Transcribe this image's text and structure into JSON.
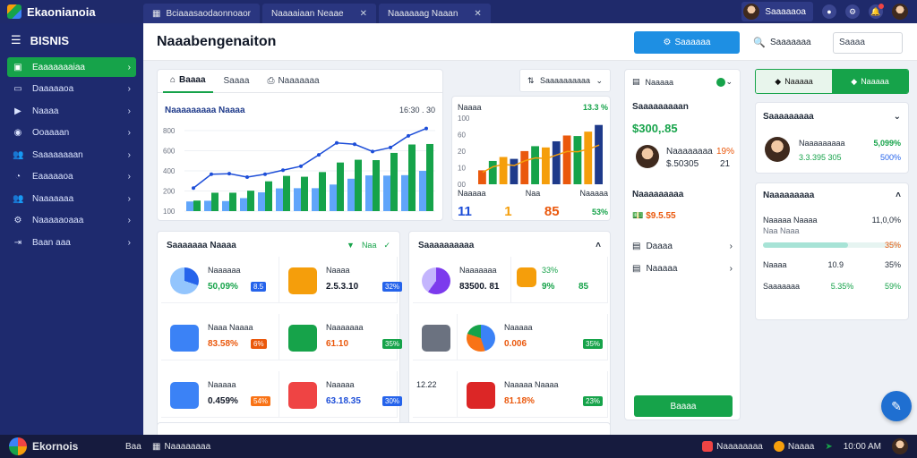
{
  "topbar": {
    "app_name": "Ekaonianoia",
    "tabs": [
      {
        "label": "Bciaaasaodaonnoaor"
      },
      {
        "label": "Naaaaiaan Neaae"
      },
      {
        "label": "Naaaaaag Naaan"
      }
    ],
    "user_name": "Saaaaaoa"
  },
  "sidebar": {
    "title": "BISNIS",
    "items": [
      {
        "label": "Eaaaaaaaiaa",
        "icon": "dashboard-icon"
      },
      {
        "label": "Daaaaaoa",
        "icon": "wallet-icon"
      },
      {
        "label": "Naaaa",
        "icon": "video-icon"
      },
      {
        "label": "Ooaaaan",
        "icon": "target-icon"
      },
      {
        "label": "Saaaaaaaan",
        "icon": "users-icon"
      },
      {
        "label": "Eaaaaaoa",
        "icon": "chart-icon"
      },
      {
        "label": "Naaaaaaa",
        "icon": "users-icon"
      },
      {
        "label": "Naaaaaoaaa",
        "icon": "settings-icon"
      },
      {
        "label": "Baan aaa",
        "icon": "export-icon"
      }
    ]
  },
  "header": {
    "title": "Naaabengenaiton",
    "primary_button": "Saaaaaa",
    "search_label": "Saaaaaaa",
    "search_value": "Saaaa"
  },
  "overview_card": {
    "tabs": [
      "Baaaa",
      "Saaaa",
      "Naaaaaaa"
    ],
    "title": "Naaaaaaaaa Naaaa",
    "range": "16:30 . 30",
    "y_ticks": [
      "800",
      "600",
      "400",
      "200",
      "100"
    ],
    "legend": {
      "bar": "Naaa",
      "line": "Baaa"
    }
  },
  "filter": {
    "label": "Saaaaaaaaaa"
  },
  "mini_chart_card": {
    "label": "Naaaa",
    "change": "13.3 %",
    "y_ticks": [
      "100",
      "60",
      "20",
      "10",
      "00"
    ],
    "stats": [
      {
        "label": "Naaaaa",
        "value": "11"
      },
      {
        "label": "Naa",
        "value": "1"
      },
      {
        "label": "Naaaaa",
        "value": "85"
      }
    ],
    "percent": "53%"
  },
  "section_left": {
    "title": "Saaaaaaa Naaaa",
    "action": "Naa",
    "tiles": [
      {
        "label": "Naaaaaa",
        "value": "50,09%",
        "change": "8.5"
      },
      {
        "label": "Naaaa",
        "value": "2.5.3.10",
        "change": "32%"
      },
      {
        "label": "Naaa Naaaa",
        "value": "83.58%",
        "change": "6%"
      },
      {
        "label": "Naaaaaaa",
        "value": "61.10",
        "change": "35%"
      },
      {
        "label": "Naaaaa",
        "value": "0.459%",
        "change": "54%"
      },
      {
        "label": "Naaaaa",
        "value": "63.18.35",
        "change": "30%"
      }
    ]
  },
  "section_right": {
    "title": "Saaaaaaaaaa",
    "tiles": [
      {
        "label": "Naaaaaaa",
        "value": "83500. 81",
        "change": "4%",
        "extra": "33%"
      },
      {
        "label": "Naaaaa",
        "value": "",
        "change": "9%",
        "extra": "85"
      },
      {
        "label": "Naaaaaaa",
        "value": "",
        "change": "",
        "extra": ""
      },
      {
        "label": "Naaaaa",
        "value": "0.006",
        "change": "35%",
        "extra": ""
      },
      {
        "label": "Naaaaa",
        "value": "",
        "change": "",
        "extra": ""
      },
      {
        "label": "Naaaaa Naaaa",
        "value": "81.18%",
        "change": "23%",
        "extra": "12.22"
      }
    ]
  },
  "profile_card": {
    "label": "Naaaaa",
    "heading": "Saaaaaaaaan",
    "amount": "$300,.85",
    "person_name": "Naaaaaaaa",
    "person_change": "19%",
    "person_value": "$.50305",
    "person_extra": "21",
    "section_title": "Naaaaaaaaa",
    "section_value": "$9.5.55",
    "links": [
      "Daaaa",
      "Naaaaa"
    ],
    "button": "Baaaa"
  },
  "segmented": {
    "left": "Naaaaa",
    "right": "Naaaaa"
  },
  "contact_card": {
    "title": "Saaaaaaaaa",
    "name": "Naaaaaaaaa",
    "change": "5,099%",
    "value": "3.3.395 305",
    "sub": "500%"
  },
  "stats_card": {
    "title": "Naaaaaaaaa",
    "rows": [
      {
        "label": "Naaaaa Naaaa",
        "value": "11,0,0%"
      },
      {
        "label": "Naa Naaa",
        "value": "35%"
      },
      {
        "label": "Naaaa",
        "mid": "10.9",
        "value": "35%"
      },
      {
        "label": "Saaaaaaa",
        "mid": "5.35%",
        "value": "59%"
      }
    ],
    "progress": 0.62
  },
  "taskbar": {
    "app_name": "Ekornois",
    "item_a": "Baa",
    "item_b": "Naaaaaaaa",
    "right_a": "Naaaaaaaa",
    "right_b": "Naaaa",
    "time": "10:00 AM"
  }
}
